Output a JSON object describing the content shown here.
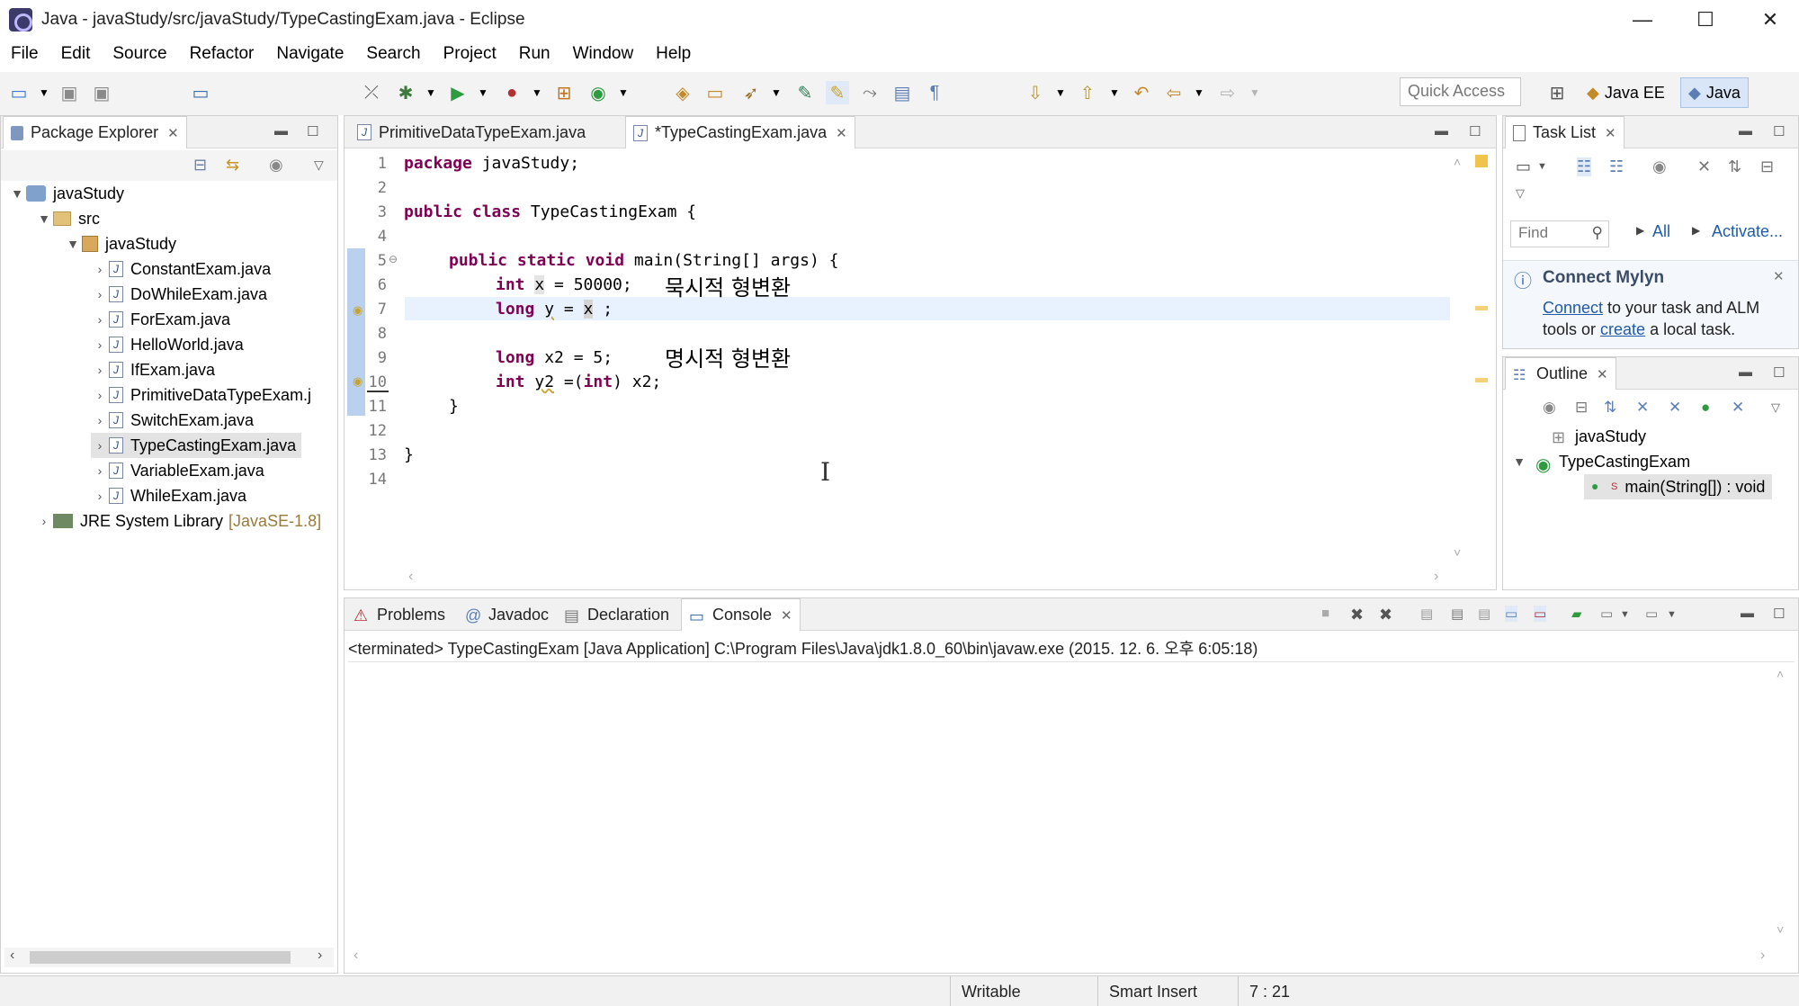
{
  "window": {
    "title": "Java - javaStudy/src/javaStudy/TypeCastingExam.java - Eclipse",
    "minimize": "—",
    "maximize": "☐",
    "close": "✕"
  },
  "menu": [
    "File",
    "Edit",
    "Source",
    "Refactor",
    "Navigate",
    "Search",
    "Project",
    "Run",
    "Window",
    "Help"
  ],
  "toolbar": {
    "quick_access_placeholder": "Quick Access",
    "perspective_javaee": "Java EE",
    "perspective_java": "Java"
  },
  "package_explorer": {
    "tab_label": "Package Explorer",
    "project": "javaStudy",
    "src": "src",
    "package": "javaStudy",
    "files": [
      "ConstantExam.java",
      "DoWhileExam.java",
      "ForExam.java",
      "HelloWorld.java",
      "IfExam.java",
      "PrimitiveDataTypeExam.j",
      "SwitchExam.java",
      "TypeCastingExam.java",
      "VariableExam.java",
      "WhileExam.java"
    ],
    "jre_label": "JRE System Library",
    "jre_version": "[JavaSE-1.8]"
  },
  "editor": {
    "tabs": [
      {
        "label": "PrimitiveDataTypeExam.java"
      },
      {
        "label": "*TypeCastingExam.java"
      }
    ],
    "line_numbers": [
      "1",
      "2",
      "3",
      "4",
      "5",
      "6",
      "7",
      "8",
      "9",
      "10",
      "11",
      "12",
      "13",
      "14"
    ],
    "code": {
      "l1_kw": "package",
      "l1_rest": " javaStudy;",
      "l3_kw": "public class",
      "l3_rest": " TypeCastingExam {",
      "l5_kw": "public static void",
      "l5_rest": " main(String[] args) {",
      "l6_kw": "int",
      "l6_var": "x",
      "l6_rest": " = 50000;",
      "l7_kw": "long",
      "l7_var": "y",
      "l7_mid": " = ",
      "l7_var2": "x",
      "l7_rest": " ;",
      "l9_kw": "long",
      "l9_rest": " x2 = 5;",
      "l10_kw": "int",
      "l10_var": "y2",
      "l10_mid": " =(",
      "l10_kw2": "int",
      "l10_rest": ") x2;",
      "l11": "}",
      "l13": "}"
    },
    "annotation_implicit": "묵시적 형변환",
    "annotation_explicit": "명시적 형변환"
  },
  "task_list": {
    "tab_label": "Task List",
    "find_placeholder": "Find",
    "all_label": "All",
    "activate_label": "Activate..."
  },
  "mylyn": {
    "title": "Connect Mylyn",
    "connect_link": "Connect",
    "text1": " to your task and ALM",
    "text2": "tools or ",
    "create_link": "create",
    "text3": " a local task."
  },
  "outline": {
    "tab_label": "Outline",
    "package": "javaStudy",
    "class": "TypeCastingExam",
    "method": "main(String[]) : void"
  },
  "bottom": {
    "tabs": [
      {
        "label": "Problems"
      },
      {
        "label": "Javadoc"
      },
      {
        "label": "Declaration"
      },
      {
        "label": "Console"
      }
    ],
    "console_header": "<terminated> TypeCastingExam [Java Application] C:\\Program Files\\Java\\jdk1.8.0_60\\bin\\javaw.exe (2015. 12. 6. 오후 6:05:18)"
  },
  "statusbar": {
    "writable": "Writable",
    "insert_mode": "Smart Insert",
    "position": "7 : 21"
  },
  "colors": {
    "keyword": "#7f0055",
    "field": "#0000c0",
    "link": "#1f5ba8",
    "current_line": "#e8f2fe"
  }
}
